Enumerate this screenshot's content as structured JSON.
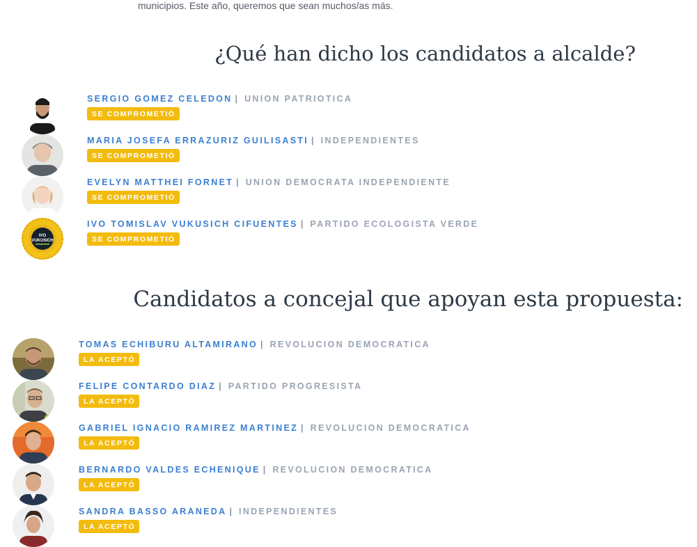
{
  "intro": {
    "text": "municipios. Este año, queremos que sean muchos/as más."
  },
  "mayors": {
    "title": "¿Qué han dicho los candidatos a alcalde?",
    "badge": "SE COMPROMETIÓ",
    "separator": "|",
    "items": [
      {
        "name": "SERGIO GOMEZ CELEDON",
        "party": "UNION PATRIOTICA"
      },
      {
        "name": "MARIA JOSEFA ERRAZURIZ GUILISASTI",
        "party": "INDEPENDIENTES"
      },
      {
        "name": "EVELYN MATTHEI FORNET",
        "party": "UNION DEMOCRATA INDEPENDIENTE"
      },
      {
        "name": "IVO TOMISLAV VUKUSICH CIFUENTES",
        "party": "PARTIDO ECOLOGISTA VERDE"
      }
    ],
    "ivo_logo": {
      "line1": "IVO",
      "line2": "VUKUSICH"
    }
  },
  "council": {
    "title": "Candidatos a concejal que apoyan esta propuesta:",
    "badge": "LA ACEPTÓ",
    "separator": "|",
    "items": [
      {
        "name": "TOMAS ECHIBURU ALTAMIRANO",
        "party": "REVOLUCION DEMOCRATICA"
      },
      {
        "name": "FELIPE CONTARDO DIAZ",
        "party": "PARTIDO PROGRESISTA"
      },
      {
        "name": "GABRIEL IGNACIO RAMIREZ MARTINEZ",
        "party": "REVOLUCION DEMOCRATICA"
      },
      {
        "name": "BERNARDO VALDES ECHENIQUE",
        "party": "REVOLUCION DEMOCRATICA"
      },
      {
        "name": "SANDRA BASSO ARANEDA",
        "party": "INDEPENDIENTES"
      }
    ]
  },
  "colors": {
    "name_blue": "#3b7fd0",
    "party_gray": "#9aa4b2",
    "badge_yellow": "#f3bb0e",
    "heading": "#2d3945"
  }
}
